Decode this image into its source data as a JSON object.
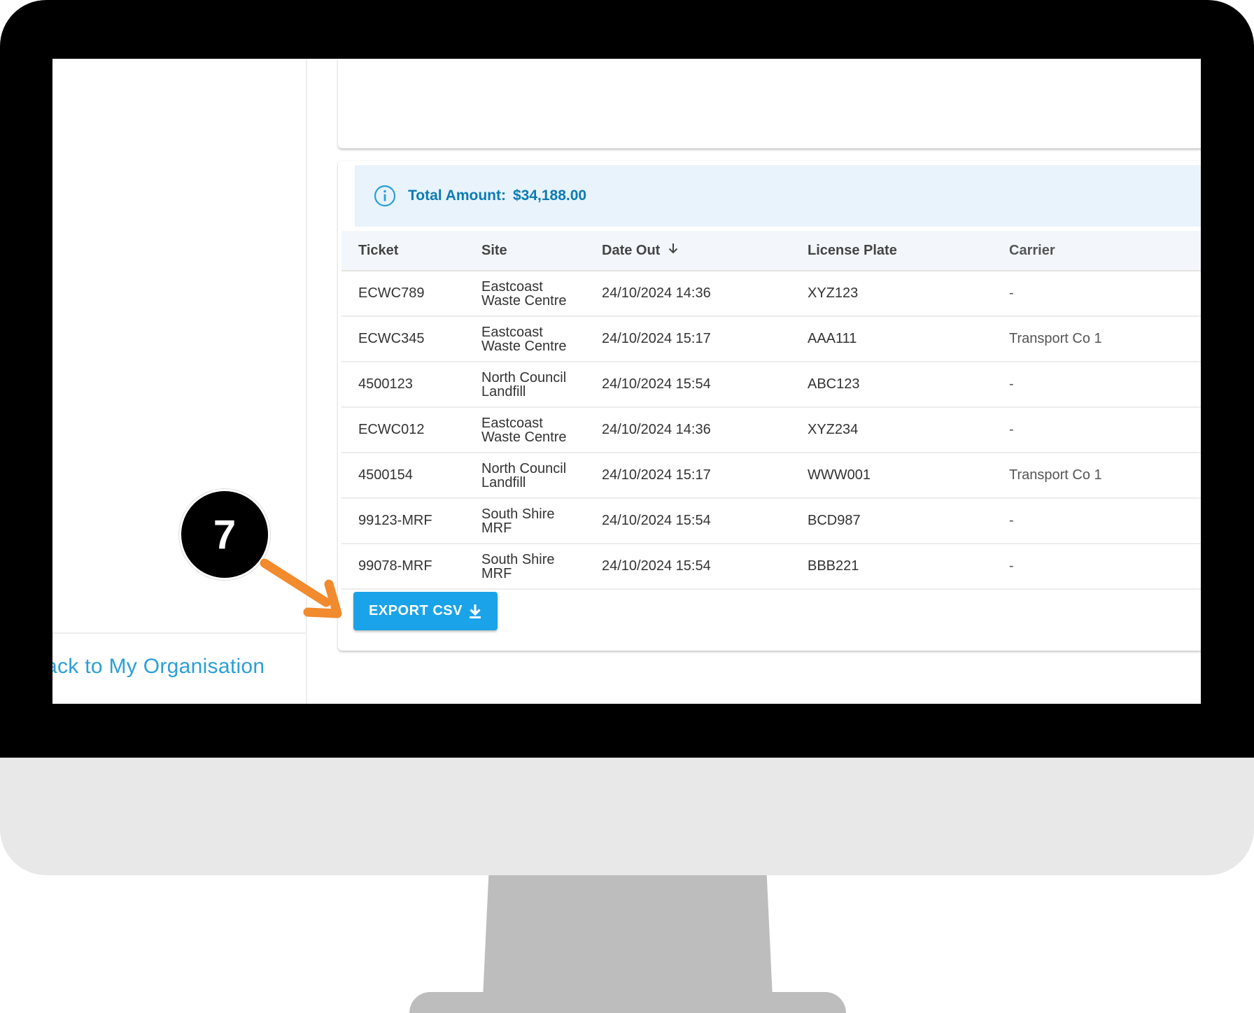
{
  "sidebar": {
    "back_link": "ack to My Organisation"
  },
  "summary": {
    "label": "Total Amount:",
    "value": "$34,188.00"
  },
  "table": {
    "headers": {
      "ticket": "Ticket",
      "site": "Site",
      "date_out": "Date Out",
      "license_plate": "License Plate",
      "carrier": "Carrier"
    },
    "rows": [
      {
        "ticket": "ECWC789",
        "site_line1": "Eastcoast",
        "site_line2": "Waste Centre",
        "date_out": "24/10/2024 14:36",
        "license_plate": "XYZ123",
        "carrier": "-"
      },
      {
        "ticket": "ECWC345",
        "site_line1": "Eastcoast",
        "site_line2": "Waste Centre",
        "date_out": "24/10/2024 15:17",
        "license_plate": "AAA111",
        "carrier": "Transport Co 1"
      },
      {
        "ticket": "4500123",
        "site_line1": "North Council",
        "site_line2": "Landfill",
        "date_out": "24/10/2024 15:54",
        "license_plate": "ABC123",
        "carrier": "-"
      },
      {
        "ticket": "ECWC012",
        "site_line1": "Eastcoast",
        "site_line2": "Waste Centre",
        "date_out": "24/10/2024 14:36",
        "license_plate": "XYZ234",
        "carrier": "-"
      },
      {
        "ticket": "4500154",
        "site_line1": "North Council",
        "site_line2": "Landfill",
        "date_out": "24/10/2024 15:17",
        "license_plate": "WWW001",
        "carrier": "Transport Co 1"
      },
      {
        "ticket": "99123-MRF",
        "site_line1": "South Shire",
        "site_line2": "MRF",
        "date_out": "24/10/2024 15:54",
        "license_plate": "BCD987",
        "carrier": "-"
      },
      {
        "ticket": "99078-MRF",
        "site_line1": "South Shire",
        "site_line2": "MRF",
        "date_out": "24/10/2024 15:54",
        "license_plate": "BBB221",
        "carrier": "-"
      }
    ]
  },
  "actions": {
    "export_label": "EXPORT CSV"
  },
  "callout": {
    "step_number": "7"
  },
  "icons": {
    "info": "info-circle-icon",
    "sort": "arrow-down-icon",
    "download": "download-icon",
    "pointer": "arrow-pointer-icon"
  },
  "colors": {
    "accent": "#1aa3e8",
    "banner_bg": "#e8f3fc",
    "banner_text": "#0c7bb3",
    "callout_arrow": "#f28a2e",
    "link": "#2b9fd6"
  }
}
